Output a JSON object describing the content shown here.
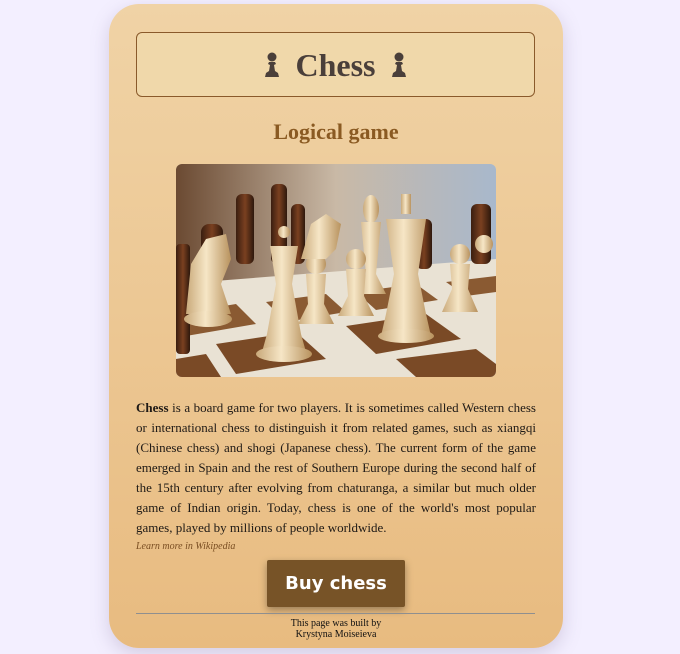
{
  "header": {
    "title": "Chess",
    "icon": "pawn-icon"
  },
  "subtitle": "Logical game",
  "image": {
    "alt": "chess pieces on a board"
  },
  "description": {
    "lead": "Chess",
    "body": " is a board game for two players. It is sometimes called Western chess or international chess to distinguish it from related games, such as xiangqi (Chinese chess) and shogi (Japanese chess). The current form of the game emerged in Spain and the rest of Southern Europe during the second half of the 15th century after evolving from chaturanga, a similar but much older game of Indian origin. Today, chess is one of the world's most popular games, played by millions of people worldwide."
  },
  "learn_more": "Learn more in Wikipedia",
  "buy_button": "Buy chess",
  "footer": {
    "line1": "This page was built by",
    "line2": "Krystyna Moiseieva"
  },
  "colors": {
    "card_top": "#f0d3a6",
    "card_bottom": "#e8bb80",
    "button": "#775327",
    "subtitle": "#8a5a22"
  }
}
